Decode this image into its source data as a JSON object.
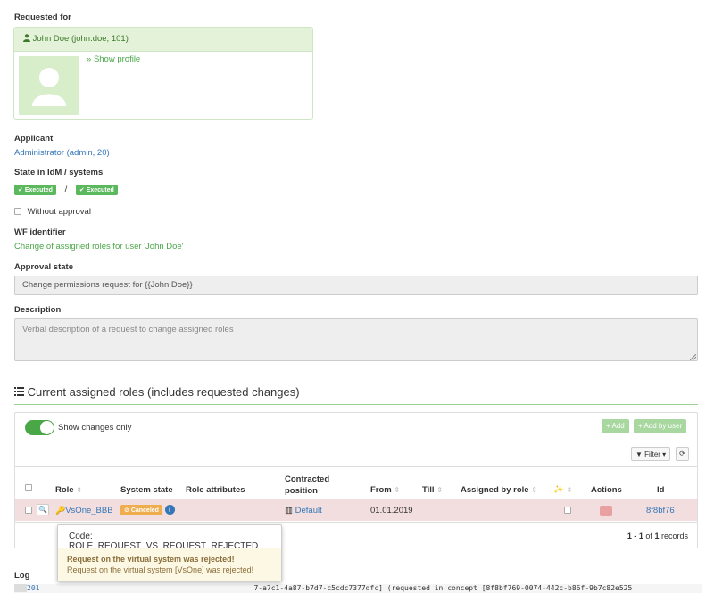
{
  "requested_for": {
    "label": "Requested for",
    "user": "John Doe (john.doe, 101)",
    "show_profile": "Show profile"
  },
  "applicant": {
    "label": "Applicant",
    "value": "Administrator (admin, 20)"
  },
  "state": {
    "label": "State in IdM / systems",
    "idm": "Executed",
    "separator": "/",
    "systems": "Executed"
  },
  "without_approval": "Without approval",
  "wf": {
    "label": "WF identifier",
    "value": "Change of assigned roles for user 'John Doe'"
  },
  "approval_state": {
    "label": "Approval state",
    "value": "Change permissions request for {{John Doe}}"
  },
  "description": {
    "label": "Description",
    "placeholder": "Verbal description of a request to change assigned roles"
  },
  "roles_section": {
    "title": "Current assigned roles (includes requested changes)",
    "show_changes_only": "Show changes only",
    "add": "Add",
    "add_by_user": "Add by user",
    "filter": "Filter",
    "columns": [
      "Role",
      "System state",
      "Role attributes",
      "Contracted position",
      "From",
      "Till",
      "Assigned by role",
      "Actions",
      "Id"
    ],
    "rows": [
      {
        "role": "VsOne_BBB",
        "system_state": "Canceled",
        "contracted_position": "Default",
        "from": "01.01.2019",
        "till": "",
        "id": "8f8bf76"
      }
    ],
    "pagination": {
      "range": "1 - 1",
      "of": "of",
      "total": "1",
      "suffix": "records"
    }
  },
  "tooltip": {
    "code": "Code: ROLE_REQUEST_VS_REQUEST_REJECTED",
    "title": "Request on the virtual system was rejected!",
    "message": "Request on the virtual system [VsOne] was rejected!"
  },
  "log": {
    "label": "Log",
    "line_start": "201",
    "line_rest": "7-a7c1-4a87-b7d7-c5cdc7377dfc] (requested in concept [8f8bf769-0074-442c-b86f-9b7c82e525"
  },
  "colors": {
    "accent": "#4aa747",
    "link": "#3476b7",
    "danger_row": "#f2dede",
    "warning": "#f0ad4e"
  }
}
